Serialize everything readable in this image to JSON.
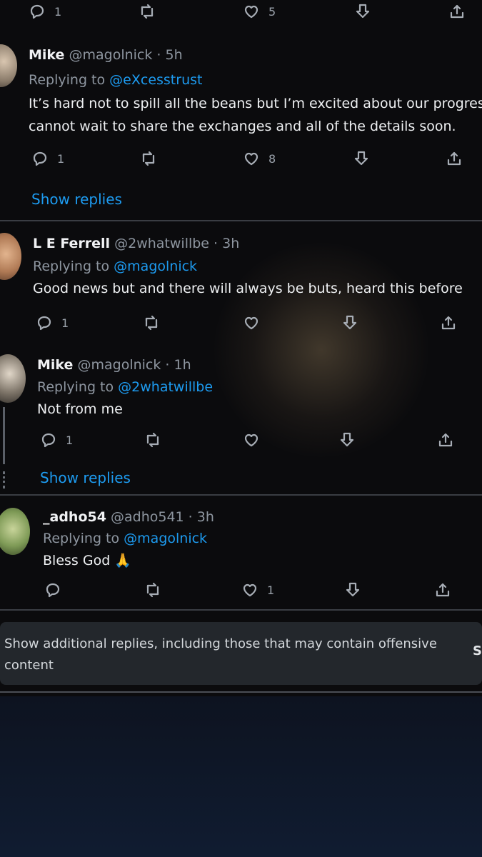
{
  "top_actions": {
    "reply_count": "1",
    "like_count": "5"
  },
  "tweets": [
    {
      "name": "Mike",
      "meta": "@magolnick · 5h",
      "replying_label": "Replying to",
      "replying_to": "@eXcesstrust",
      "lines": [
        "It’s hard not to spill all the beans but I’m excited about our progres",
        "cannot wait to share the exchanges and all of the details soon."
      ],
      "reply_count": "1",
      "like_count": "8",
      "show_replies": "Show replies"
    },
    {
      "name": "L E Ferrell",
      "meta": "@2whatwillbe · 3h",
      "replying_label": "Replying to",
      "replying_to": "@magolnick",
      "lines": [
        "Good news but and there will always be buts, heard this before"
      ],
      "reply_count": "1"
    },
    {
      "name": "Mike",
      "meta": "@magolnick · 1h",
      "replying_label": "Replying to",
      "replying_to": "@2whatwillbe",
      "lines": [
        "Not from me"
      ],
      "reply_count": "1",
      "show_replies": "Show replies"
    },
    {
      "name": "_adho54",
      "meta": "@adho541 · 3h",
      "replying_label": "Replying to",
      "replying_to": "@magolnick",
      "lines": [
        "Bless God 🙏"
      ],
      "like_count": "1"
    }
  ],
  "notice": {
    "text": "Show additional replies, including those that may contain offensive content",
    "tail": "S"
  },
  "icons": {
    "reply": "reply-icon",
    "retweet": "retweet-icon",
    "like": "heart-icon",
    "bookmark": "bookmark-icon",
    "share": "share-icon"
  },
  "colors": {
    "background": "#0b0b0d",
    "accent": "#1d9bf0",
    "muted": "#8e96a0",
    "notice_bg": "#23272c"
  }
}
